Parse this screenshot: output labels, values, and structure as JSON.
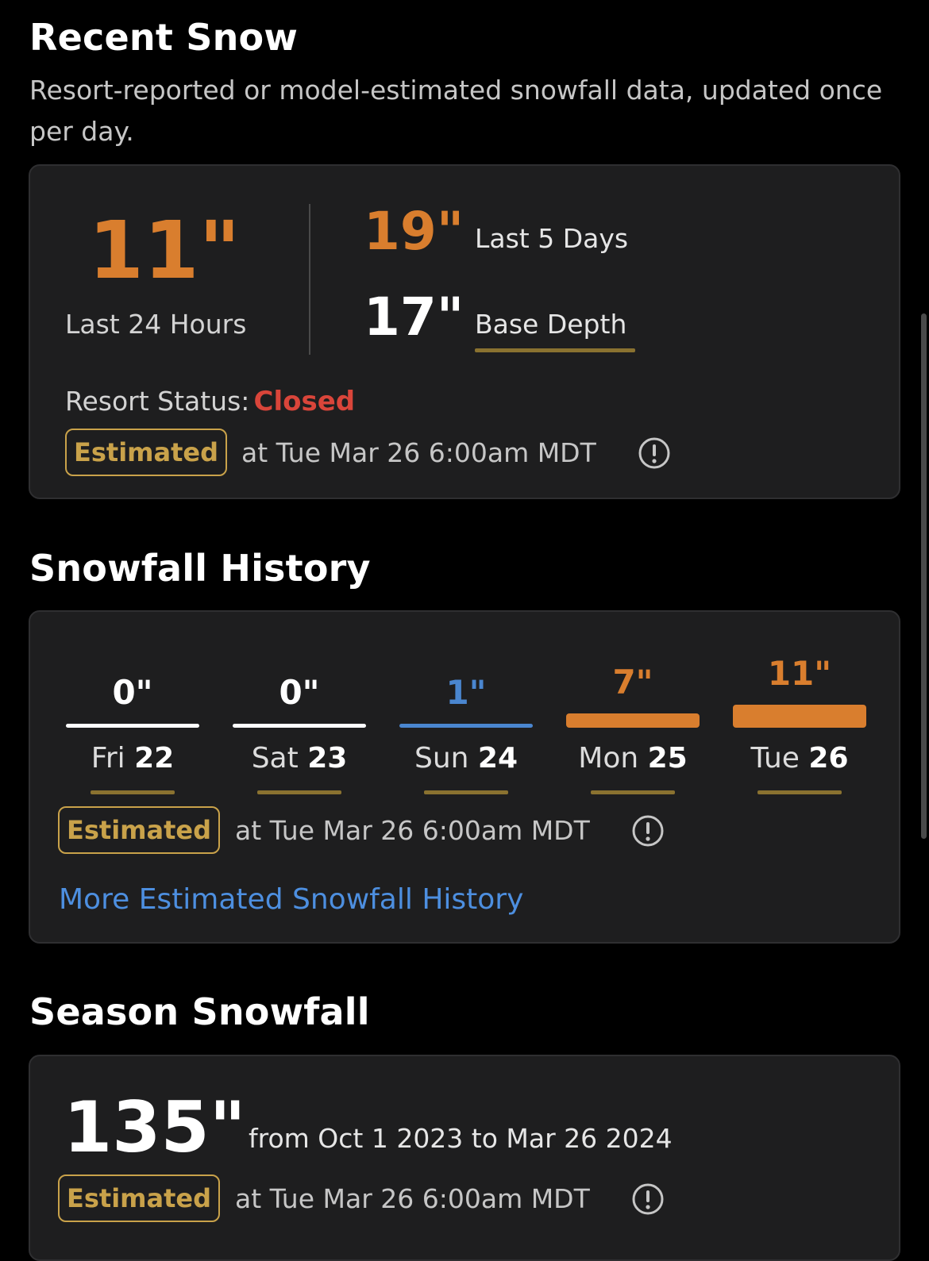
{
  "recent_snow": {
    "title": "Recent Snow",
    "subtitle": "Resort-reported or model-estimated snowfall data, updated once per day.",
    "last_24_value": "11\"",
    "last_24_label": "Last 24 Hours",
    "last_5_value": "19\"",
    "last_5_label": "Last 5 Days",
    "base_depth_value": "17\"",
    "base_depth_label": "Base Depth",
    "status_label": "Resort Status:",
    "status_value": "Closed",
    "badge": "Estimated",
    "timestamp": "at Tue Mar 26 6:00am MDT"
  },
  "history": {
    "title": "Snowfall History",
    "days": [
      {
        "value": "0\"",
        "dow": "Fri",
        "date": "22",
        "amount": 0,
        "color": "#ffffff"
      },
      {
        "value": "0\"",
        "dow": "Sat",
        "date": "23",
        "amount": 0,
        "color": "#ffffff"
      },
      {
        "value": "1\"",
        "dow": "Sun",
        "date": "24",
        "amount": 1,
        "color": "#4a86cf"
      },
      {
        "value": "7\"",
        "dow": "Mon",
        "date": "25",
        "amount": 7,
        "color": "#d97e2e"
      },
      {
        "value": "11\"",
        "dow": "Tue",
        "date": "26",
        "amount": 11,
        "color": "#d97e2e"
      }
    ],
    "badge": "Estimated",
    "timestamp": "at Tue Mar 26 6:00am MDT",
    "link": "More Estimated Snowfall History"
  },
  "season": {
    "title": "Season Snowfall",
    "value": "135\"",
    "range": "from Oct 1 2023 to Mar 26 2024",
    "badge": "Estimated",
    "timestamp": "at Tue Mar 26 6:00am MDT"
  },
  "colors": {
    "accent_orange": "#d97e2e",
    "badge_gold": "#c9a24a",
    "status_red": "#d9453a",
    "link_blue": "#4d8fe0"
  },
  "icons": [
    "info-icon"
  ]
}
